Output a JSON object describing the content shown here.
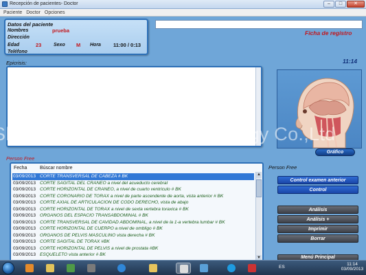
{
  "window": {
    "title": "Recepción de pacientes- Doctor"
  },
  "menu": [
    "Paciente",
    "Doctor",
    "Opciones"
  ],
  "patient": {
    "section_title": "Datos del paciente",
    "name_label": "Nombres",
    "name_value": "prueba",
    "address_label": "Dirección",
    "age_label": "Edad",
    "age_value": "23",
    "sex_label": "Sexo",
    "sex_value": "M",
    "time_label": "Hora",
    "time_value": "11:00 / 0:13",
    "phone_label": "Teléfono"
  },
  "header": {
    "ficha": "Ficha de registro",
    "clock": "11:14"
  },
  "epicrisis": {
    "label": "Epicrisis:"
  },
  "image_panel": {
    "button": "Gráfico"
  },
  "list": {
    "section_label": "Person Free",
    "col_date": "Fecha",
    "col_name": "Búscar nombre",
    "rows": [
      {
        "date": "03/09/2013",
        "name": "CORTE TRANSVERSAL DE CABEZA # BK",
        "selected": true
      },
      {
        "date": "03/09/2013",
        "name": "CORTE SAGITAL DEL CRANEO a nivel del acueducto cerebral",
        "selected": false
      },
      {
        "date": "03/09/2013",
        "name": "CORTE HORIZONTAL DE CRANEO, a nivel de cuarto ventriculo # BK",
        "selected": false
      },
      {
        "date": "03/09/2013",
        "name": "CORTE CORONARIO DE TORAX a nivel de parte ascendente de aorta, vista anterior # BK",
        "selected": false
      },
      {
        "date": "03/09/2013",
        "name": "CORTE AXIAL DE ARTICULACION DE CODO DERECHO, vista de abajo",
        "selected": false
      },
      {
        "date": "03/09/2013",
        "name": "CORTE HORIZONTAL DE TORAX a nivel de sexta vertebra toraxica # BK",
        "selected": false
      },
      {
        "date": "03/09/2013",
        "name": "ORGANOS DEL ESPACIO TRANSABDOMINAL # BK",
        "selected": false
      },
      {
        "date": "03/09/2013",
        "name": "CORTE TRANSVERSAL DE CAVIDAD ABDOMINAL, a nivel de la 1-a vertebra lumbar # BK",
        "selected": false
      },
      {
        "date": "03/09/2013",
        "name": "CORTE HORIZONTAL DE CUERPO a nivel de ombligo # BK",
        "selected": false
      },
      {
        "date": "03/09/2013",
        "name": "ORGANOS DE PELVIS MASCULINO vista derecha # BK",
        "selected": false
      },
      {
        "date": "03/09/2013",
        "name": "CORTE SAGITAL  DE TORAX #BK",
        "selected": false
      },
      {
        "date": "03/09/2013",
        "name": "CORTE HORIZONTAL DE PELVIS a nivel de prostata #BK",
        "selected": false
      },
      {
        "date": "03/09/2013",
        "name": "ESQUELETO vista anterior # BK",
        "selected": false
      }
    ]
  },
  "sidebar": {
    "label": "Person Free",
    "buttons": {
      "control_examen": "Control examen anterior",
      "control": "Control",
      "analisis": "Análisis",
      "analisis_plus": "Análisis +",
      "imprimir": "Imprimir",
      "borrar": "Borrar",
      "menu_principal": "Menú Principal"
    }
  },
  "watermark": "Shenzhen Phenitech Technology Co.,Ltd",
  "taskbar": {
    "lang": "ES",
    "time": "11:14",
    "date": "03/09/2013"
  }
}
